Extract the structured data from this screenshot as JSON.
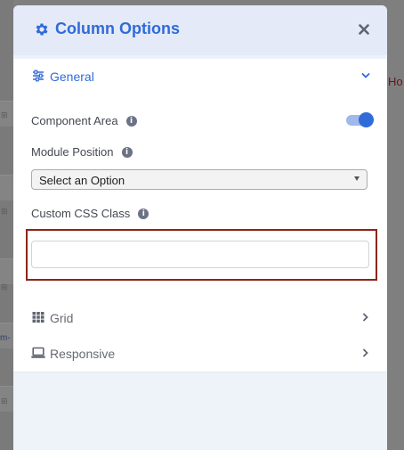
{
  "modal": {
    "title": "Column Options",
    "icon": "gear-icon",
    "close_icon": "close-icon"
  },
  "sections": {
    "general": {
      "label": "General",
      "icon": "sliders-icon",
      "expanded": true,
      "fields": {
        "component_area": {
          "label": "Component Area",
          "enabled": true
        },
        "module_position": {
          "label": "Module Position",
          "selected": "Select an Option"
        },
        "custom_css_class": {
          "label": "Custom CSS Class",
          "value": "",
          "placeholder": ""
        }
      }
    },
    "grid": {
      "label": "Grid",
      "icon": "grid-icon",
      "expanded": false
    },
    "responsive": {
      "label": "Responsive",
      "icon": "laptop-icon",
      "expanded": false
    }
  },
  "background": {
    "right_text": "Ho",
    "left_text": "m-"
  },
  "colors": {
    "accent": "#2f6bd9",
    "highlight_border": "#8b2616",
    "header_bg": "#e4eaf8"
  }
}
